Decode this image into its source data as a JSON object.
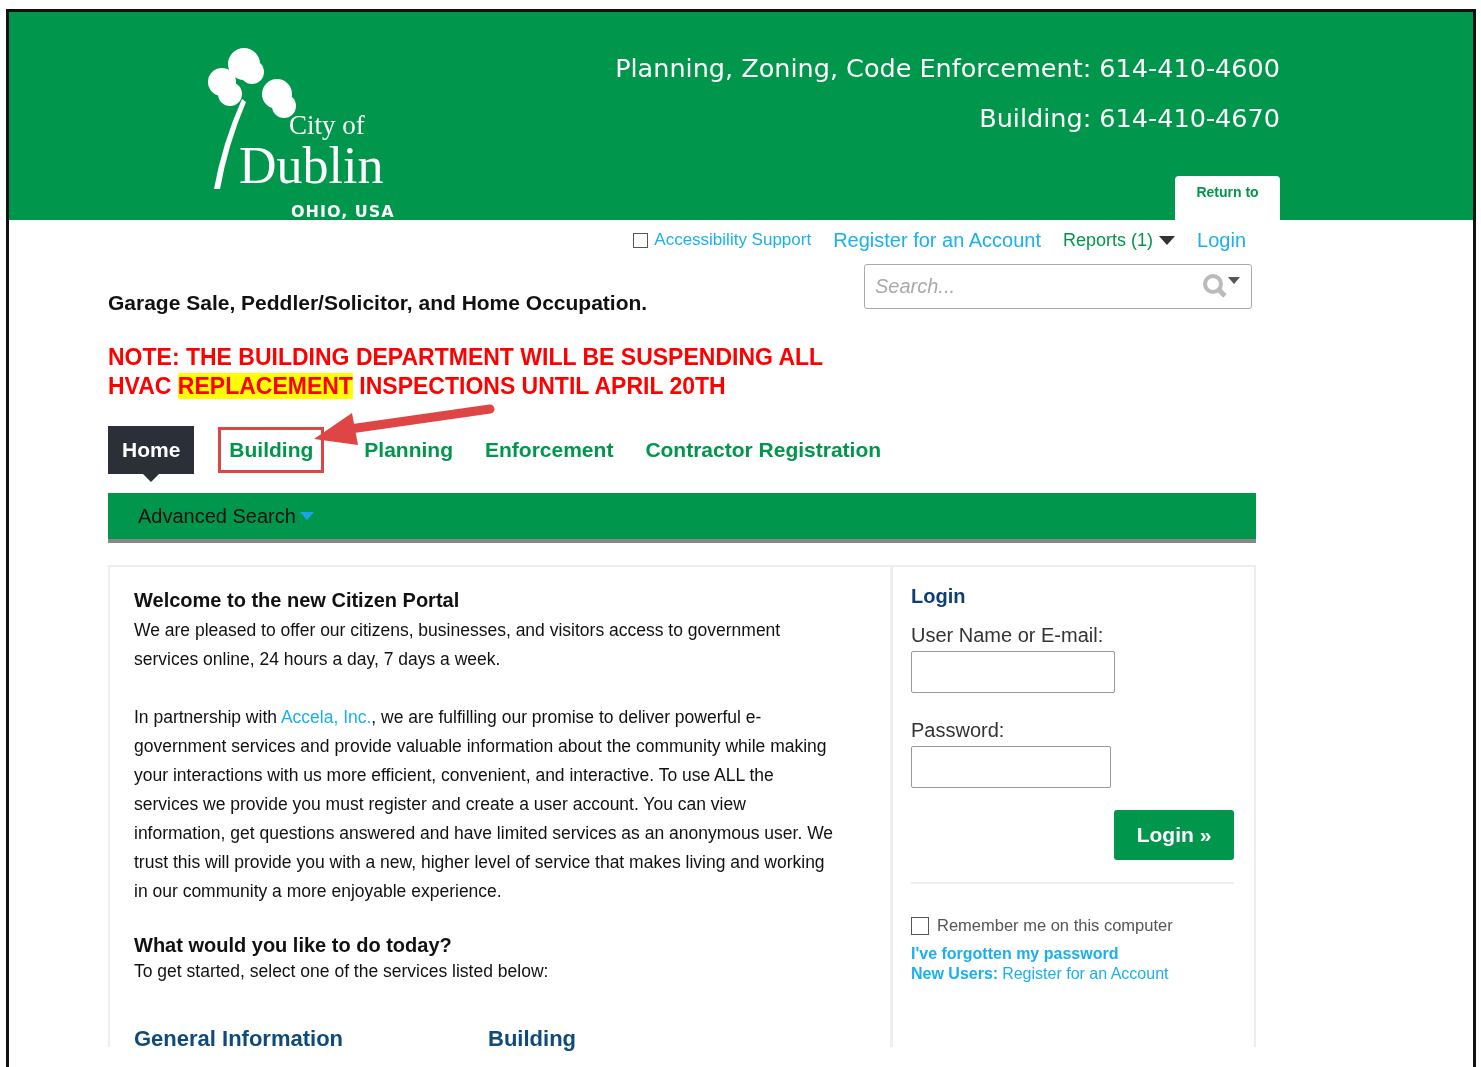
{
  "header": {
    "logo": {
      "line_1": "City of",
      "line_2": "Dublin",
      "line_3": "OHIO, USA"
    },
    "phones": [
      "Planning, Zoning, Code Enforcement: 614-410-4600",
      "Building: 614-410-4670"
    ],
    "return_tab": "Return to"
  },
  "top_links": {
    "accessibility": {
      "label": "Accessibility Support",
      "checked": false
    },
    "register": "Register for an Account",
    "reports": "Reports (1)",
    "login": "Login"
  },
  "search": {
    "placeholder": "Search..."
  },
  "intro_line": "Garage Sale, Peddler/Solicitor, and Home Occupation.",
  "notice": "NOTE: THE BUILDING DEPARTMENT WILL BE SUSPENDING ALL HVAC ",
  "notice_highlight": "REPLACEMENT",
  "notice_end": " INSPECTIONS UNTIL APRIL 20TH",
  "tabs": [
    {
      "label": "Home",
      "selected": true,
      "annotated": false
    },
    {
      "label": "Building",
      "selected": false,
      "annotated": true
    },
    {
      "label": "Planning",
      "selected": false,
      "annotated": false
    },
    {
      "label": "Enforcement",
      "selected": false,
      "annotated": false
    },
    {
      "label": "Contractor Registration",
      "selected": false,
      "annotated": false
    }
  ],
  "subnav": {
    "label": "Advanced Search"
  },
  "welcome": {
    "title": "Welcome to the new Citizen Portal",
    "text_1": "We are pleased to offer our citizens, businesses, and visitors access to government services online, 24 hours a day, 7 days a week.",
    "text_2_before": "In partnership with ",
    "link": "Accela, Inc.",
    "text_2_after": ", we are fulfilling our promise to deliver powerful e-government services and provide valuable information about the community while making your interactions with us more efficient, convenient, and interactive. To use ALL the services we provide you must register and create a user account. You can view information, get questions answered and have limited services as an anonymous user. We trust this will provide you with a new, higher level of service that makes living and working in our community a more enjoyable experience.",
    "question": "What would you like to do today?",
    "prompt": "To get started, select one of the services listed below:",
    "sections": [
      "General Information",
      "Building"
    ]
  },
  "login_panel": {
    "title": "Login",
    "username_label": "User Name or E-mail:",
    "password_label": "Password:",
    "button": "Login »",
    "remember": {
      "label": "Remember me on this computer",
      "checked": false
    },
    "forgot": "I've forgotten my password",
    "new_users": "New Users:",
    "register": "Register for an Account"
  }
}
